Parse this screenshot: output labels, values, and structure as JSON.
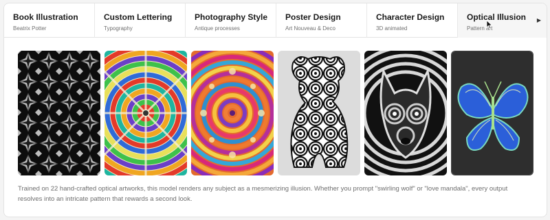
{
  "tabs": [
    {
      "title": "Book Illustration",
      "subtitle": "Beatrix Potter"
    },
    {
      "title": "Custom Lettering",
      "subtitle": "Typography"
    },
    {
      "title": "Photography Style",
      "subtitle": "Antique processes"
    },
    {
      "title": "Poster Design",
      "subtitle": "Art Nouveau & Deco"
    },
    {
      "title": "Character Design",
      "subtitle": "3D animated"
    },
    {
      "title": "Optical Illusion",
      "subtitle": "Pattern art"
    }
  ],
  "next_icon": "chevron-right-icon",
  "gallery": [
    {
      "icon": "geometric-star-pattern-image"
    },
    {
      "icon": "rainbow-vortex-image"
    },
    {
      "icon": "heart-mandala-image"
    },
    {
      "icon": "swirl-dog-image"
    },
    {
      "icon": "swirling-wolf-image"
    },
    {
      "icon": "wavy-butterfly-image"
    }
  ],
  "caption": "Trained on 22 hand-crafted optical artworks, this model renders any subject as a mesmerizing illusion. Whether you prompt \"swirling wolf\" or \"love mandala\", every output resolves into an intricate pattern that rewards a second look.",
  "colors": {
    "accent": "#1a1a1a",
    "muted": "#6d6d6d",
    "border": "#e3e3e3"
  }
}
